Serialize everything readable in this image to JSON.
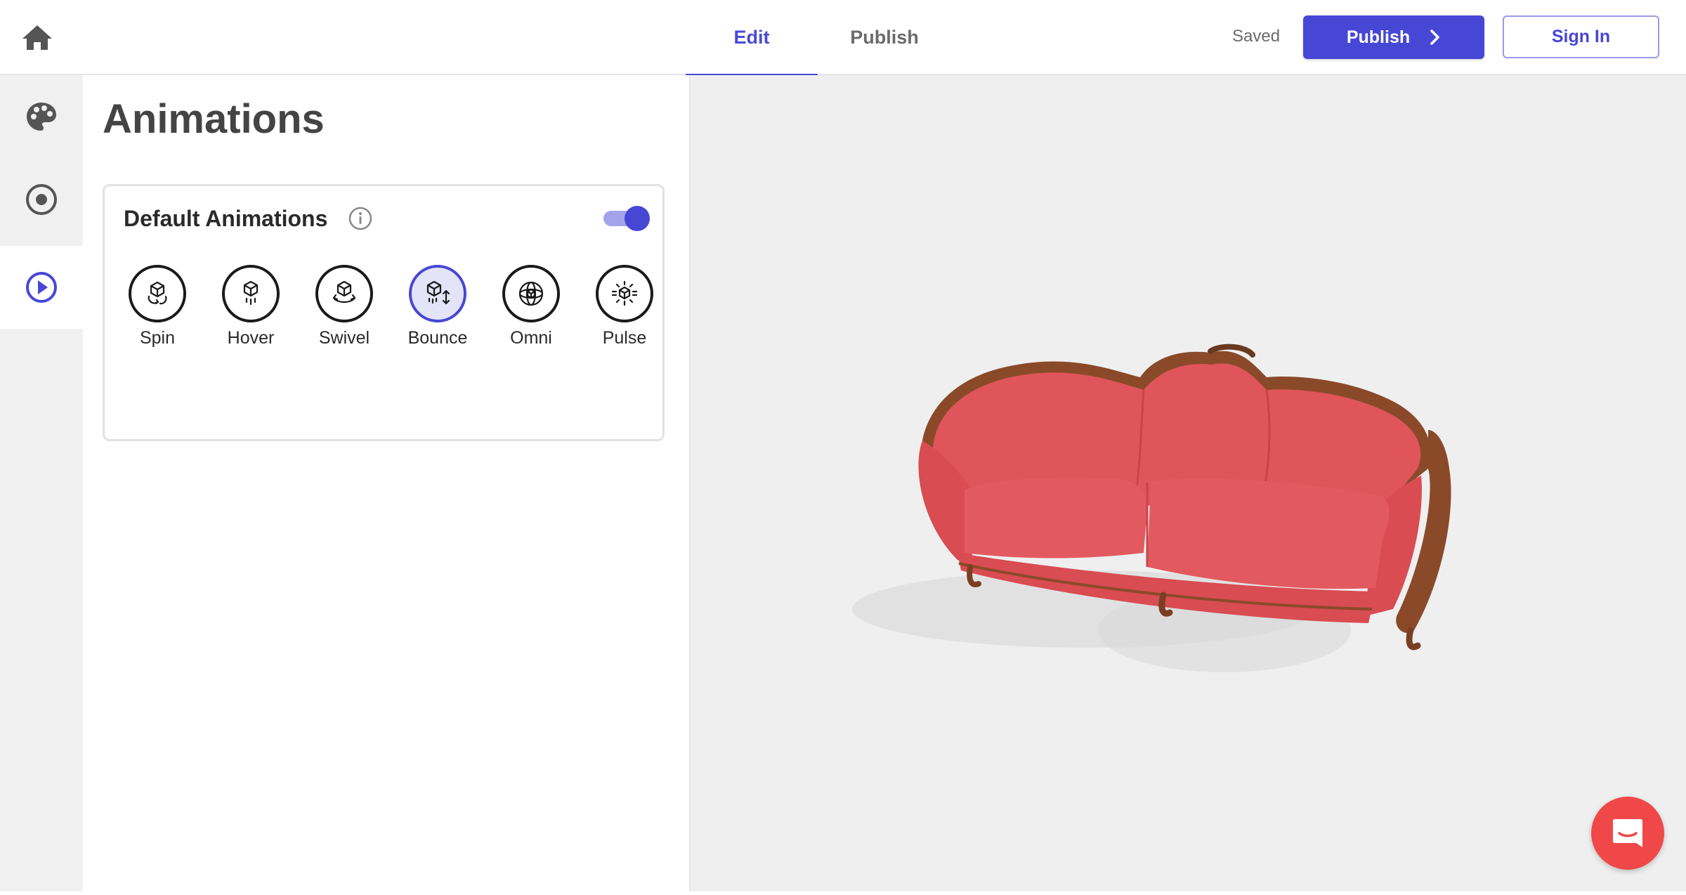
{
  "header": {
    "tabs": [
      {
        "label": "Edit",
        "active": true
      },
      {
        "label": "Publish",
        "active": false
      }
    ],
    "status": "Saved",
    "publish_label": "Publish",
    "signin_label": "Sign In"
  },
  "rail": {
    "items": [
      {
        "icon": "palette-icon"
      },
      {
        "icon": "target-icon"
      },
      {
        "icon": "play-circle-icon",
        "active": true
      }
    ]
  },
  "panel": {
    "title": "Animations",
    "card": {
      "title": "Default Animations",
      "enabled": true,
      "animations": [
        {
          "label": "Spin",
          "selected": false
        },
        {
          "label": "Hover",
          "selected": false
        },
        {
          "label": "Swivel",
          "selected": false
        },
        {
          "label": "Bounce",
          "selected": true
        },
        {
          "label": "Omni",
          "selected": false
        },
        {
          "label": "Pulse",
          "selected": false
        }
      ]
    }
  },
  "colors": {
    "accent": "#4747d6",
    "sofa": "#e0555a",
    "chat": "#f04848"
  }
}
